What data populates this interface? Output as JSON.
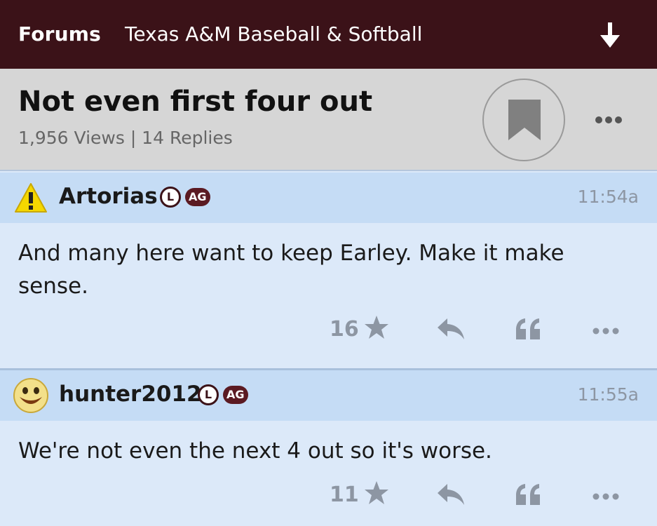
{
  "topbar": {
    "forums_label": "Forums",
    "forum_name": "Texas A&M Baseball & Softball",
    "jump_icon": "arrow-down-icon"
  },
  "thread": {
    "title": "Not even first four out",
    "stats": "1,956 Views | 14 Replies",
    "bookmark_icon": "bookmark-icon",
    "more_icon": "more-options-icon"
  },
  "posts": [
    {
      "username": "Artorias",
      "avatar_icon": "warning-icon",
      "badge_l": "L",
      "badge_ag": "AG",
      "time": "11:54a",
      "text": "And many here want to keep Earley. Make it make sense.",
      "likes": "16"
    },
    {
      "username": "hunter2012",
      "avatar_icon": "smiley-icon",
      "badge_l": "L",
      "badge_ag": "AG",
      "time": "11:55a",
      "text": "We're not even the next 4 out so it's worse.",
      "likes": "11"
    }
  ],
  "colors": {
    "brand": "#3b1218",
    "header_bg": "#d6d6d6",
    "post_header_bg": "#c5dcf5",
    "post_body_bg": "#dce9f9",
    "muted": "#8d96a3"
  }
}
